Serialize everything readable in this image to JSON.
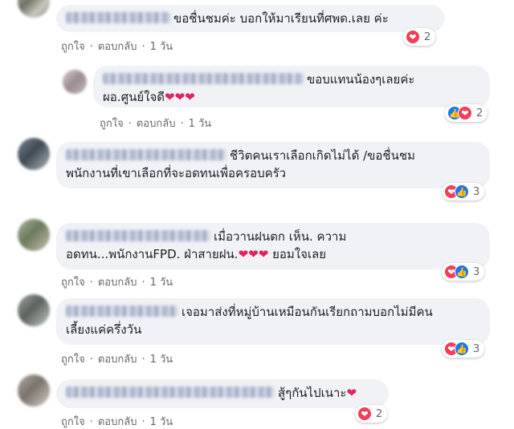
{
  "actions": {
    "like": "ถูกใจ",
    "reply": "ตอบกลับ",
    "dot": "·",
    "time": "1 วัน"
  },
  "icons": {
    "like": "like-icon",
    "love": "love-icon"
  },
  "colors": {
    "bubble": "#f0f2f5",
    "like": "#1877f2",
    "love": "#f33e58",
    "meta": "#65676b"
  },
  "comments": [
    {
      "text": "ขอชื่นชมค่ะ บอกให้มาเรียนที่ศพด.เลย ค่ะ",
      "reactions": "2"
    },
    {
      "text_line1": "ขอบแทนน้องๆเลยค่ะ",
      "text_line2": "ผอ.ศูนย์ใจดี",
      "hearts": "❤❤❤",
      "reactions": "2"
    },
    {
      "text_line1": "ชีวิตคนเราเลือกเกิดไม่ได้ /ขอชื่นชม",
      "text_line2": "พนักงานที่เขาเลือกที่จะอดทนเพื่อครอบครัว",
      "reactions": "3"
    },
    {
      "text_line1": "เมื่อวานฝนตก เห็น. ความ",
      "text_line2a": "อดทน...พนักงานFPD. ฝ่าสายฝน.",
      "hearts": "❤❤❤",
      "text_line2b": "ยอมใจเลย",
      "reactions": "3"
    },
    {
      "text_line1": "เจอมาส่งที่หมู่บ้านเหมือนกันเรียกถามบอกไม่มีคน",
      "text_line2": "เลี้ยงแค่ครึ่งวัน",
      "reactions": "3"
    },
    {
      "text": "สู้ๆกันไปเนาะ",
      "heart": "❤",
      "reactions": "2"
    }
  ]
}
